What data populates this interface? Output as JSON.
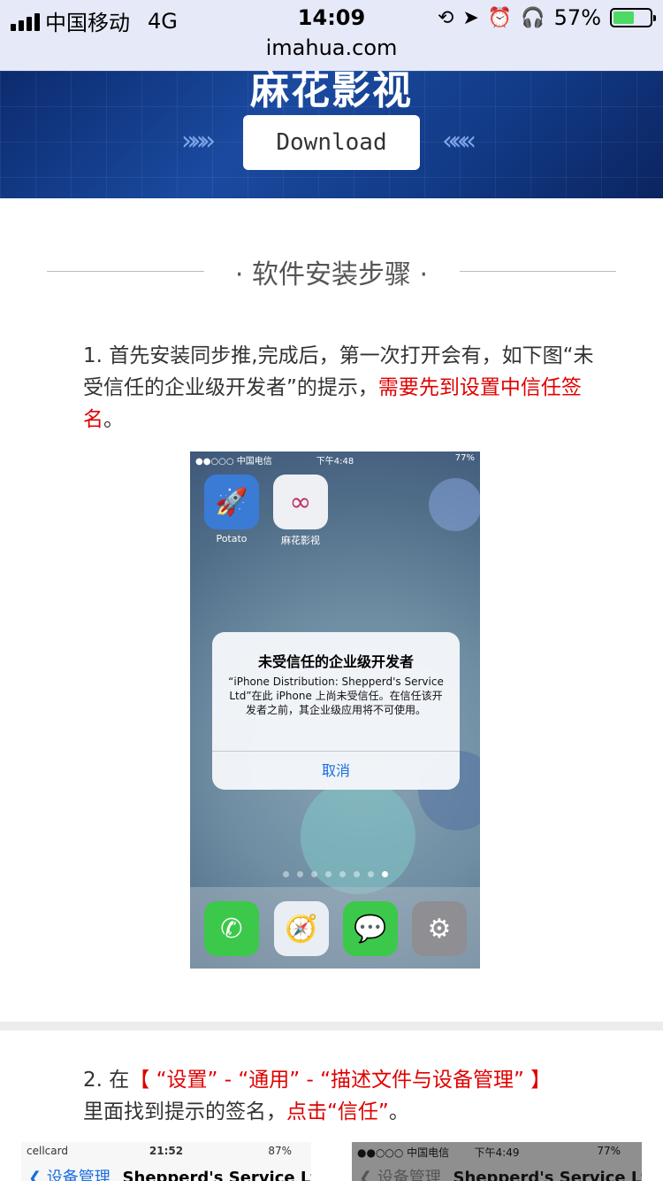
{
  "status": {
    "carrier": "中国移动",
    "network": "4G",
    "time": "14:09",
    "battery": "57%",
    "battery_level": 0.57,
    "icons": [
      "rotation-lock-icon",
      "location-icon",
      "alarm-icon",
      "headphones-icon"
    ]
  },
  "url": "imahua.com",
  "banner": {
    "title": "麻花影视",
    "download_label": "Download",
    "left_chevrons": "»»»",
    "right_chevrons": "«««"
  },
  "section": {
    "title": "· 软件安装步骤 ·"
  },
  "step1": {
    "text_plain": "1. 首先安装同步推,完成后，第一次打开会有，如下图“未受信任的企业级开发者”的提示，",
    "text_red": "需要先到设置中信任签名",
    "text_end": "。"
  },
  "shot1": {
    "carrier": "●●○○○ 中国电信",
    "time": "下午4:48",
    "battery": "77%",
    "apps": [
      {
        "label": "Potato",
        "icon": "rocket-icon"
      },
      {
        "label": "麻花影视",
        "icon": "infinity-icon"
      }
    ],
    "alert": {
      "title": "未受信任的企业级开发者",
      "body": "“iPhone Distribution: Shepperd's Service Ltd”在此 iPhone 上尚未受信任。在信任该开发者之前，其企业级应用将不可使用。",
      "button": "取消"
    },
    "page_dots": 8,
    "active_dot": 8,
    "dock": [
      "phone-icon",
      "safari-icon",
      "messages-icon",
      "settings-icon"
    ]
  },
  "step2": {
    "prefix": "2. 在",
    "red1": "【 “设置” - “通用” - “描述文件与设备管理” 】",
    "mid": "里面找到提示的签名，",
    "red2": "点击“信任”",
    "end": "。"
  },
  "shot2": {
    "carrier": "cellcard",
    "time": "21:52",
    "battery": "87%",
    "back": "设备管理",
    "title": "Shepperd's Service Ltd"
  },
  "shot3": {
    "carrier": "●●○○○ 中国电信",
    "time": "下午4:49",
    "battery": "77%",
    "back": "设备管理",
    "title": "Shepperd's Service Ltd"
  }
}
